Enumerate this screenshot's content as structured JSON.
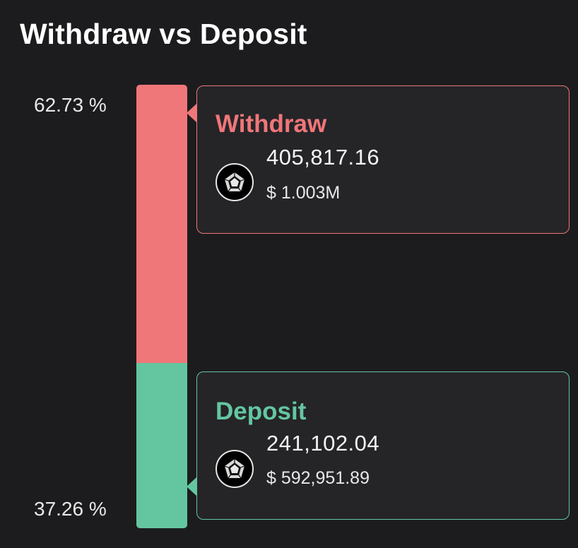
{
  "colors": {
    "withdraw": "#ef7679",
    "deposit": "#64c6a0",
    "background": "#1c1c1e",
    "card_bg": "#252528"
  },
  "chart_data": {
    "type": "bar",
    "title": "Withdraw vs Deposit",
    "orientation": "vertical-stacked-100",
    "categories": [
      "Withdraw",
      "Deposit"
    ],
    "series": [
      {
        "name": "Withdraw",
        "percent_label": "62.73 %",
        "percent": 62.73,
        "amount": "405,817.16",
        "usd": "$ 1.003M",
        "token_icon": "pentagon-token-icon"
      },
      {
        "name": "Deposit",
        "percent_label": "37.26 %",
        "percent": 37.26,
        "amount": "241,102.04",
        "usd": "$ 592,951.89",
        "token_icon": "pentagon-token-icon"
      }
    ],
    "ylim": [
      0,
      100
    ],
    "legend": "none",
    "grid": false
  }
}
